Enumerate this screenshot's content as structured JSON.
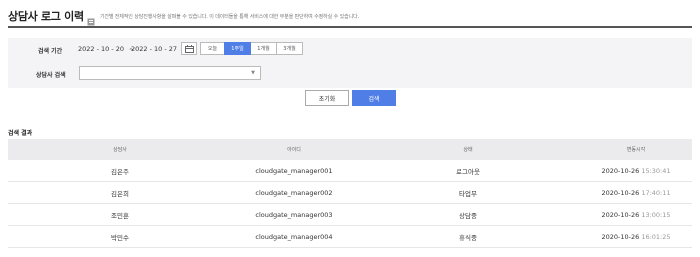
{
  "header": {
    "title": "상담사 로그 이력",
    "description": "기간별 전체적인 상담진행사항을 살펴볼 수 있습니다. 이 데이터들을 통해 서비스에 대한 부분을 판단하여 수정하실 수 있습니다."
  },
  "filters": {
    "period_label": "검색 기간",
    "start_date": "2022 - 10 - 20",
    "date_sep": "~",
    "end_date": "2022 - 10 - 27",
    "periods": [
      "오늘",
      "1주일",
      "1개월",
      "3개월"
    ],
    "active_period": "1주일",
    "agent_label": "상담사 검색",
    "agent_value": "",
    "select_arrow": "▼"
  },
  "buttons": {
    "reset": "초기화",
    "search": "검색"
  },
  "results": {
    "title": "검색 결과",
    "columns": [
      "상담사",
      "아이디",
      "상태",
      "변동시각"
    ],
    "rows": [
      {
        "name": "김은주",
        "id": "cloudgate_manager001",
        "status": "로그아웃",
        "date": "2020-10-26",
        "time": "15:30:41"
      },
      {
        "name": "김은희",
        "id": "cloudgate_manager002",
        "status": "타업무",
        "date": "2020-10-26",
        "time": "17:40:11"
      },
      {
        "name": "조민훈",
        "id": "cloudgate_manager003",
        "status": "상담중",
        "date": "2020-10-26",
        "time": "13:00:15"
      },
      {
        "name": "박민수",
        "id": "cloudgate_manager004",
        "status": "휴식중",
        "date": "2020-10-26",
        "time": "16:01:25"
      }
    ]
  },
  "colors": {
    "accent": "#4f7fe6",
    "filter_bg": "#f4f4f6",
    "header_bg": "#ebebed"
  }
}
